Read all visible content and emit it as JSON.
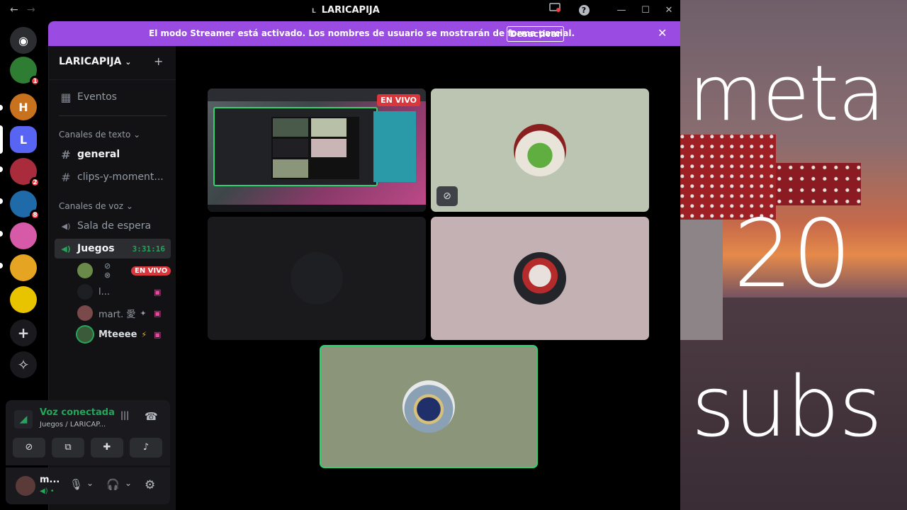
{
  "window": {
    "server_short": "L",
    "title": "LARICAPIJA",
    "back_glyph": "←",
    "forward_glyph": "→",
    "help_glyph": "?",
    "minimize_glyph": "—",
    "maximize_glyph": "☐",
    "close_glyph": "✕"
  },
  "banner": {
    "message": "El modo Streamer está activado. Los nombres de usuario se mostrarán de forma parcial.",
    "button": "Desactivar",
    "close_glyph": "✕"
  },
  "guilds": [
    {
      "name": "discord-home",
      "glyph": "◉",
      "color": "#2b2d31",
      "badge": ""
    },
    {
      "name": "frog-server",
      "glyph": "",
      "color": "#2e7d32",
      "badge": "1"
    },
    {
      "name": "h-server",
      "glyph": "H",
      "color": "#c9721e",
      "badge": ""
    },
    {
      "name": "laricapija",
      "glyph": "L",
      "color": "#5865f2",
      "badge": ""
    },
    {
      "name": "dark-server",
      "glyph": "",
      "color": "#a92c3d",
      "badge": "2"
    },
    {
      "name": "club-server",
      "glyph": "",
      "color": "#1f6aa8",
      "badge": "8"
    },
    {
      "name": "anime-server",
      "glyph": "",
      "color": "#d65aa8",
      "badge": ""
    },
    {
      "name": "pooh-server",
      "glyph": "",
      "color": "#e5a422",
      "badge": ""
    },
    {
      "name": "gift-server",
      "glyph": "",
      "color": "#e8c400",
      "badge": ""
    },
    {
      "name": "add-server",
      "glyph": "+",
      "color": "#1a1a1e",
      "badge": ""
    },
    {
      "name": "explore",
      "glyph": "✧",
      "color": "#1a1a1e",
      "badge": ""
    }
  ],
  "sidebar": {
    "server_name": "LARICAPIJA",
    "server_chevron": "⌄",
    "invite_glyph": "+",
    "events_label": "Eventos",
    "events_glyph": "▦",
    "text_category": "Canales de texto",
    "voice_category": "Canales de voz",
    "category_chevron": "⌄",
    "text_channels": [
      {
        "label": "general",
        "glyph": "#"
      },
      {
        "label": "clips-y-moment...",
        "glyph": "#"
      }
    ],
    "voice_channels": [
      {
        "label": "Sala de espera",
        "glyph": "◀)"
      },
      {
        "label": "Juegos",
        "timer": "3:31:16",
        "glyph": "◀)"
      }
    ],
    "voice_users": [
      {
        "name": "",
        "live": "EN VIVO",
        "icons": "⊘ ⊗",
        "color": "#6a8a4a"
      },
      {
        "name": "l...",
        "icons": "",
        "color": "#1e1f22"
      },
      {
        "name": "mart. 愛",
        "icons": "✦",
        "color": "#7a4a4a"
      },
      {
        "name": "Mteeee",
        "icons": "⚡",
        "color": "#3a5a3a"
      }
    ],
    "voice_user_flag": "▣"
  },
  "voice_panel": {
    "title": "Voz conectada",
    "subtitle": "Juegos / LARICAP...",
    "signal_glyph": "◢",
    "noise_glyph": "|||",
    "disconnect_glyph": "☎",
    "buttons": [
      {
        "name": "camera-off-button",
        "glyph": "⊘"
      },
      {
        "name": "share-screen-button",
        "glyph": "⧉"
      },
      {
        "name": "activities-button",
        "glyph": "✚"
      },
      {
        "name": "soundboard-button",
        "glyph": "♪"
      }
    ]
  },
  "user_panel": {
    "name": "m...",
    "status": "◀) •",
    "mic_glyph": "🎙",
    "headset_glyph": "🎧",
    "dropdown_glyph": "⌄",
    "settings_glyph": "⚙"
  },
  "stage": {
    "live_badge": "EN VIVO",
    "hidden_video_glyph": "⊘"
  },
  "overlay": {
    "line1": "meta",
    "line2": "20",
    "line3": "subs"
  },
  "colors": {
    "streamer_banner": "#9a4be2",
    "connected_green": "#23a55a",
    "live_red": "#da373c",
    "speaking_outline": "#2dd36f"
  }
}
